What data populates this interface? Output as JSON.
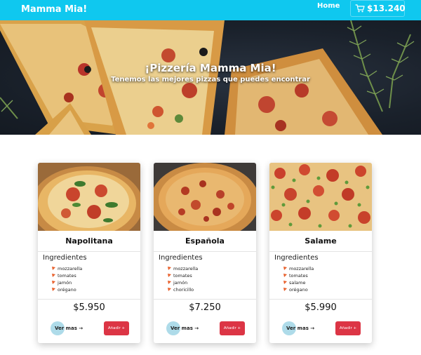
{
  "navbar": {
    "brand": "Mamma Mia!",
    "home_label": "Home",
    "cart_total": "$13.240"
  },
  "hero": {
    "title": "¡Pizzería Mamma Mia!",
    "subtitle": "Tenemos las mejores pizzas que puedes encontrar"
  },
  "pizzas": [
    {
      "name": "Napolitana",
      "ingredients_title": "Ingredientes",
      "ingredients": [
        "mozzarella",
        "tomates",
        "jamón",
        "orégano"
      ],
      "price": "$5.950",
      "see_more": "Ver mas →",
      "add": "Añadir +"
    },
    {
      "name": "Española",
      "ingredients_title": "Ingredientes",
      "ingredients": [
        "mozzarella",
        "tomates",
        "jamón",
        "choricillo"
      ],
      "price": "$7.250",
      "see_more": "Ver mas →",
      "add": "Añadir +"
    },
    {
      "name": "Salame",
      "ingredients_title": "Ingredientes",
      "ingredients": [
        "mozzarella",
        "tomates",
        "salame",
        "orégano"
      ],
      "price": "$5.990",
      "see_more": "Ver mas →",
      "add": "Añadir +"
    }
  ],
  "colors": {
    "navbar": "#0fc8ef",
    "add_button": "#dc3545",
    "see_more_bubble": "#aedbe9",
    "ingredient_icon": "#e8602c"
  },
  "icons": {
    "cart": "cart-icon",
    "ingredient": "pizza-slice-icon"
  }
}
